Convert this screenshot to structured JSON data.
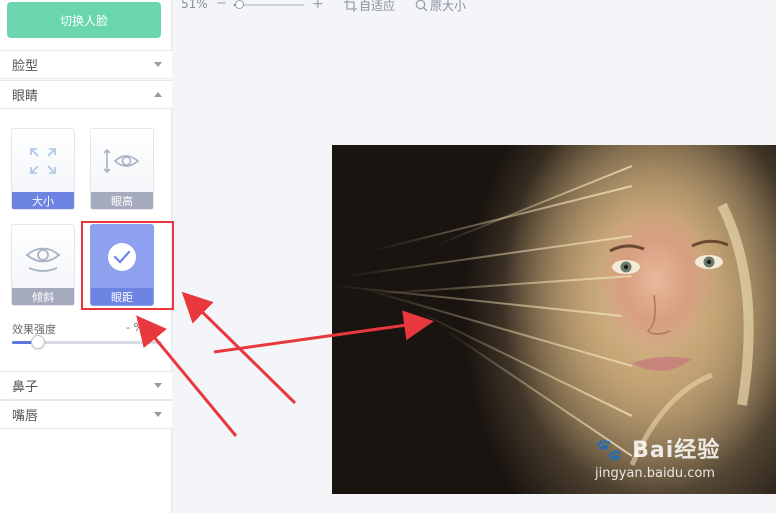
{
  "sidebar": {
    "switch_button": "切换人脸",
    "sections": {
      "face_shape": "脸型",
      "eyes": "眼睛",
      "nose": "鼻子",
      "lips": "嘴唇"
    },
    "eye_tiles": [
      {
        "label": "大小",
        "icon": "expand-icon"
      },
      {
        "label": "眼高",
        "icon": "eye-height-icon"
      },
      {
        "label": "倾斜",
        "icon": "eye-tilt-icon"
      },
      {
        "label": "眼距",
        "icon": "check-icon",
        "selected": true
      }
    ],
    "strength": {
      "label": "效果强度",
      "value": "-  %",
      "level": 0.17
    }
  },
  "toolbar": {
    "zoom_percent": "51%",
    "zoom_minus": "−",
    "zoom_plus": "+",
    "zoom_level": 0.07,
    "fit_label": "自适应",
    "original_label": "原大小"
  },
  "watermark": {
    "brand": "Bai",
    "brand_cn": "经验",
    "url": "jingyan.baidu.com"
  },
  "colors": {
    "accent": "#5c78e0",
    "switch_green": "#4fcfa0",
    "annotation_red": "#e8383d"
  }
}
